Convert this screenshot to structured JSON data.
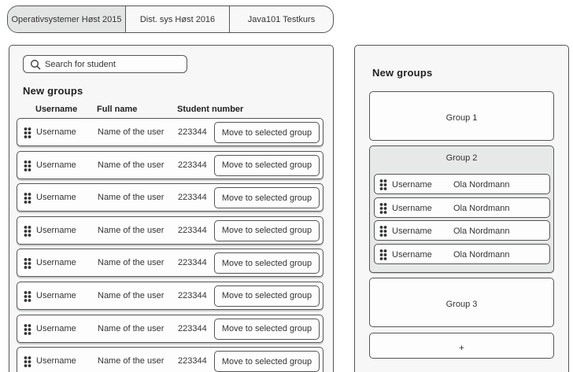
{
  "tabs": [
    {
      "label": "Operativsystemer Høst 2015",
      "active": true
    },
    {
      "label": "Dist. sys Høst 2016",
      "active": false
    },
    {
      "label": "Java101 Testkurs",
      "active": false
    }
  ],
  "left": {
    "search_placeholder": "Search for student",
    "title": "New groups",
    "columns": {
      "username": "Username",
      "full_name": "Full name",
      "student_number": "Student number"
    },
    "students": [
      {
        "username": "Username",
        "full_name": "Name of the user",
        "number": "223344",
        "action": "Move to selected group"
      },
      {
        "username": "Username",
        "full_name": "Name of the user",
        "number": "223344",
        "action": "Move to selected group"
      },
      {
        "username": "Username",
        "full_name": "Name of the user",
        "number": "223344",
        "action": "Move to selected group"
      },
      {
        "username": "Username",
        "full_name": "Name of the user",
        "number": "223344",
        "action": "Move to selected group"
      },
      {
        "username": "Username",
        "full_name": "Name of the user",
        "number": "223344",
        "action": "Move to selected group"
      },
      {
        "username": "Username",
        "full_name": "Name of the user",
        "number": "223344",
        "action": "Move to selected group"
      },
      {
        "username": "Username",
        "full_name": "Name of the user",
        "number": "223344",
        "action": "Move to selected group"
      },
      {
        "username": "Username",
        "full_name": "Name of the user",
        "number": "223344",
        "action": "Move to selected group"
      }
    ]
  },
  "right": {
    "title": "New groups",
    "groups": [
      {
        "label": "Group 1",
        "members": []
      },
      {
        "label": "Group 2",
        "selected": true,
        "members": [
          {
            "username": "Username",
            "full_name": "Ola Nordmann"
          },
          {
            "username": "Username",
            "full_name": "Ola Nordmann"
          },
          {
            "username": "Username",
            "full_name": "Ola Nordmann"
          },
          {
            "username": "Username",
            "full_name": "Ola Nordmann"
          }
        ]
      },
      {
        "label": "Group 3",
        "members": []
      }
    ],
    "add_label": "+"
  },
  "icons": {
    "search": "search-icon",
    "drag": "drag-handle-icon"
  }
}
